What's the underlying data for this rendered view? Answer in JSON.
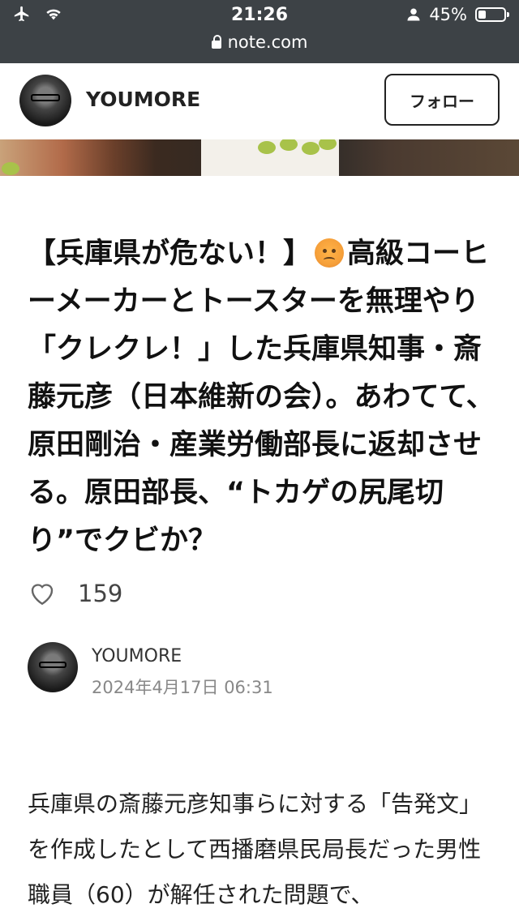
{
  "status_bar": {
    "time": "21:26",
    "battery": "45%",
    "battery_level": 0.45,
    "icons": [
      "airplane-icon",
      "wifi-icon",
      "person-icon",
      "battery-icon"
    ]
  },
  "browser": {
    "url": "note.com"
  },
  "header": {
    "name": "YOUMORE",
    "follow_label": "フォロー"
  },
  "article": {
    "title_part1": "【兵庫県が危ない！】",
    "title_part2": "高級コーヒーメーカーとトースターを無理やり「クレクレ！」した兵庫県知事・斎藤元彦（日本維新の会）。あわてて、原田剛治・産業労働部長に返却させる。原田部長、“トカゲの尻尾切り”でクビか？",
    "likes": "159",
    "author": "YOUMORE",
    "date": "2024年4月17日 06:31",
    "body": "兵庫県の斎藤元彦知事らに対する「告発文」を作成したとして西播磨県民局長だった男性職員（60）が解任された問題で、"
  },
  "colors": {
    "browser_bar": "#3d4246",
    "text": "#111111",
    "muted": "#888888"
  }
}
